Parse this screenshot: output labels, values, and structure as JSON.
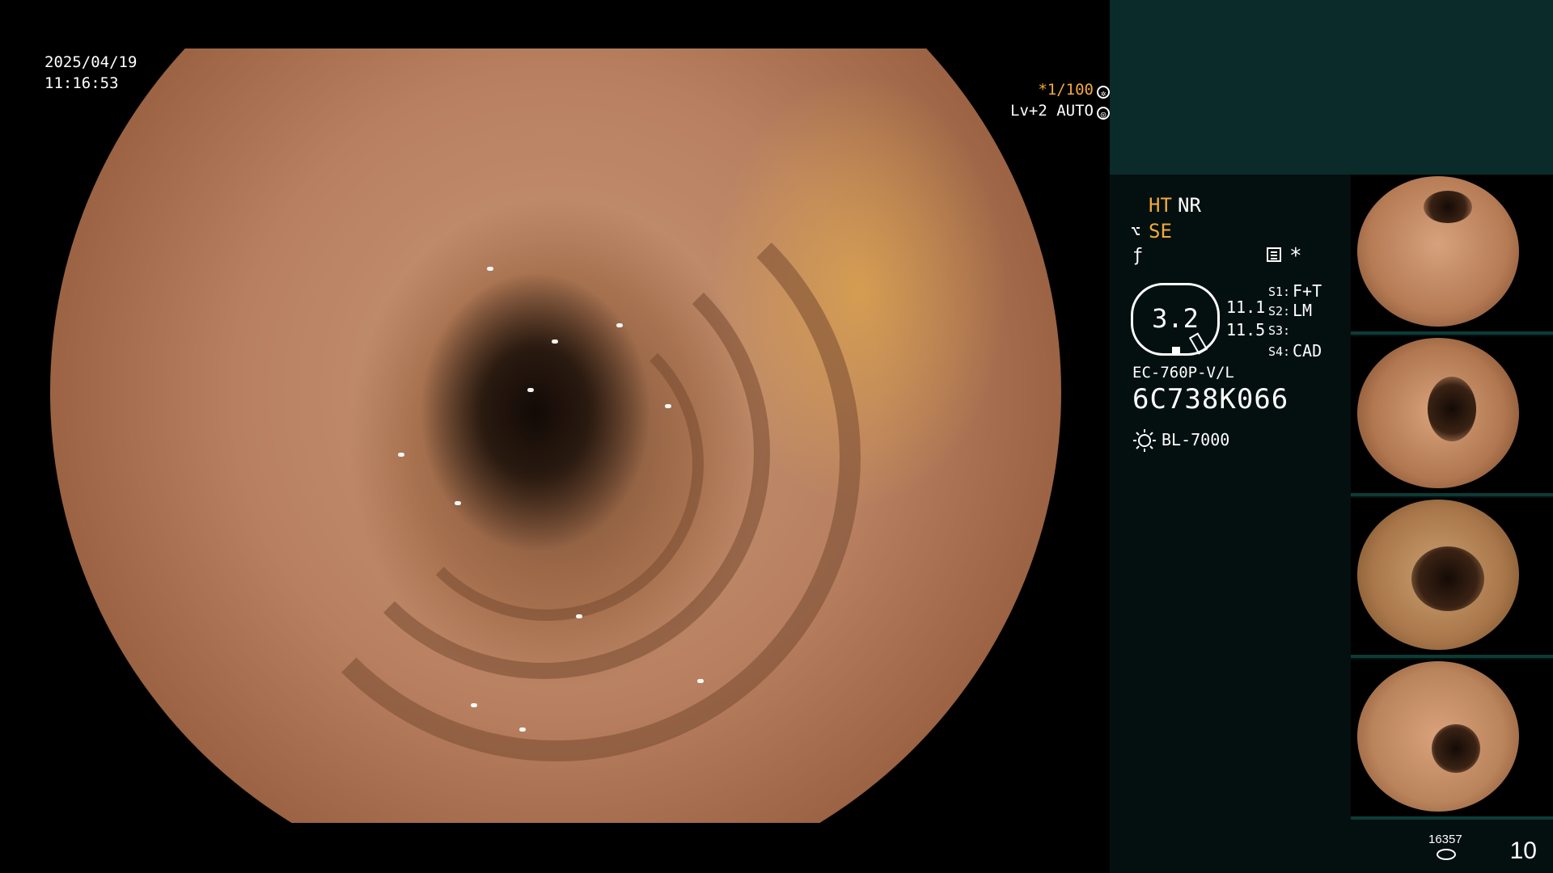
{
  "overlay": {
    "date": "2025/04/19",
    "time": "11:16:53",
    "shutter_label": "*1/100",
    "level_label": "Lv+2 AUTO"
  },
  "panel": {
    "mode_ht": "HT",
    "mode_nr": "NR",
    "mode_se": "SE",
    "gauge_value": "3.2",
    "value_a": "11.1",
    "value_b": "11.5",
    "s1_label": "S1:",
    "s1_value": "F+T",
    "s2_label": "S2:",
    "s2_value": "LM",
    "s3_label": "S3:",
    "s3_value": "",
    "s4_label": "S4:",
    "s4_value": "CAD",
    "scope_model": "EC-760P-V/L",
    "scope_serial": "6C738K066",
    "light_source": "BL-7000"
  },
  "footer": {
    "small_count": "16357",
    "image_count": "10"
  },
  "colors": {
    "accent": "#f2a83b",
    "panel_top": "#0b2b2b",
    "panel_bg": "#03100f"
  },
  "icons": [
    "gear-icon",
    "gear-icon",
    "scissors-icon",
    "f-stop-icon",
    "menu-icon",
    "star-icon",
    "light-icon",
    "disk-icon"
  ]
}
